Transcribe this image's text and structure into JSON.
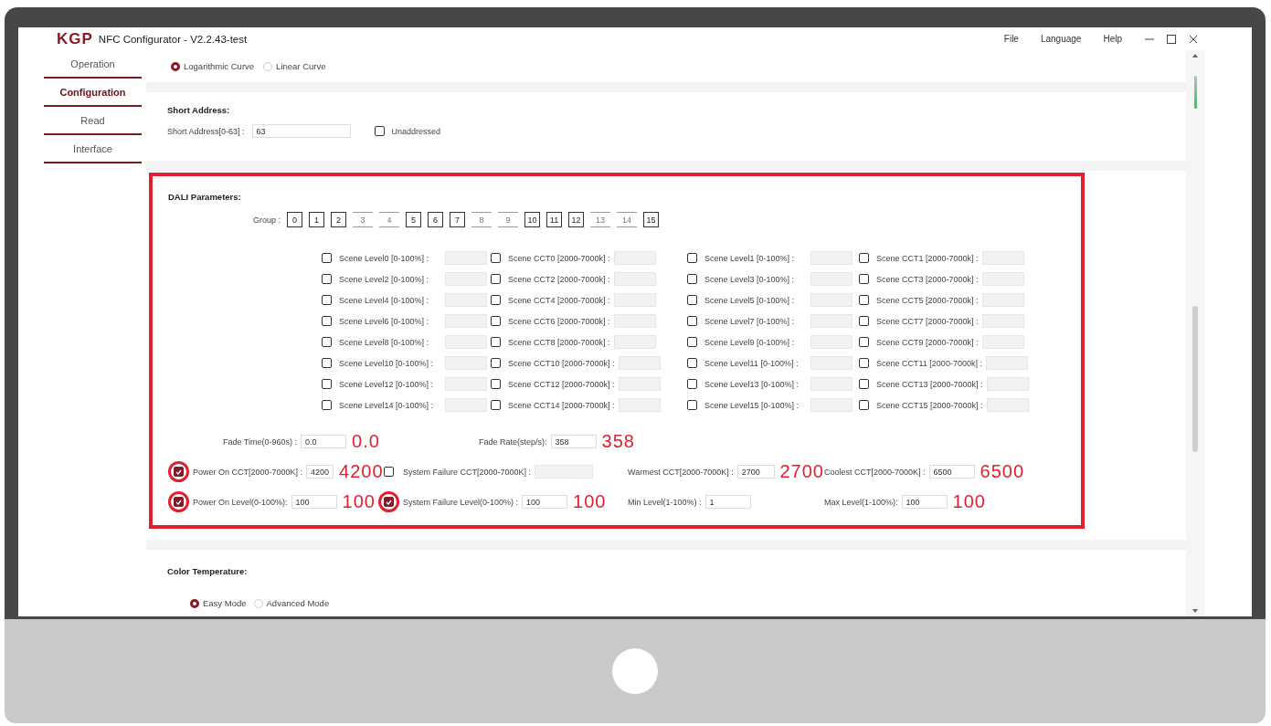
{
  "app": {
    "logo": "KGP",
    "title": "NFC Configurator - V2.2.43-test",
    "menu": [
      "File",
      "Language",
      "Help"
    ]
  },
  "sidebar": {
    "items": [
      {
        "label": "Operation",
        "selected": false
      },
      {
        "label": "Configuration",
        "selected": true
      },
      {
        "label": "Read",
        "selected": false
      },
      {
        "label": "Interface",
        "selected": false
      }
    ]
  },
  "curve": {
    "options": [
      {
        "label": "Logarithmic Curve",
        "selected": true
      },
      {
        "label": "Linear Curve",
        "selected": false
      }
    ]
  },
  "short_address": {
    "title": "Short Address:",
    "label": "Short Address[0-63] :",
    "value": "63",
    "unaddressed": {
      "label": "Unaddressed",
      "checked": false
    }
  },
  "dali": {
    "title": "DALI Parameters:",
    "group_label": "Group :",
    "groups": [
      {
        "label": "0",
        "selected": true
      },
      {
        "label": "1",
        "selected": true
      },
      {
        "label": "2",
        "selected": true
      },
      {
        "label": "3",
        "selected": false
      },
      {
        "label": "4",
        "selected": false
      },
      {
        "label": "5",
        "selected": true
      },
      {
        "label": "6",
        "selected": true
      },
      {
        "label": "7",
        "selected": true
      },
      {
        "label": "8",
        "selected": false
      },
      {
        "label": "9",
        "selected": false
      },
      {
        "label": "10",
        "selected": true
      },
      {
        "label": "11",
        "selected": true
      },
      {
        "label": "12",
        "selected": true
      },
      {
        "label": "13",
        "selected": false
      },
      {
        "label": "14",
        "selected": false
      },
      {
        "label": "15",
        "selected": true
      }
    ],
    "scenes": [
      {
        "label": "Scene Level0 [0-100%] :",
        "checked": false,
        "disabled": true
      },
      {
        "label": "Scene CCT0 [2000-7000k] :",
        "checked": false,
        "disabled": true
      },
      {
        "label": "Scene Level1 [0-100%] :",
        "checked": false,
        "disabled": true
      },
      {
        "label": "Scene CCT1 [2000-7000k] :",
        "checked": false,
        "disabled": true
      },
      {
        "label": "Scene Level2 [0-100%] :",
        "checked": false,
        "disabled": true
      },
      {
        "label": "Scene CCT2 [2000-7000k] :",
        "checked": false,
        "disabled": true
      },
      {
        "label": "Scene Level3 [0-100%] :",
        "checked": false,
        "disabled": true
      },
      {
        "label": "Scene CCT3 [2000-7000k] :",
        "checked": false,
        "disabled": true
      },
      {
        "label": "Scene Level4 [0-100%] :",
        "checked": false,
        "disabled": true
      },
      {
        "label": "Scene CCT4 [2000-7000k] :",
        "checked": false,
        "disabled": true
      },
      {
        "label": "Scene Level5 [0-100%] :",
        "checked": false,
        "disabled": true
      },
      {
        "label": "Scene CCT5 [2000-7000k] :",
        "checked": false,
        "disabled": true
      },
      {
        "label": "Scene Level6 [0-100%] :",
        "checked": false,
        "disabled": true
      },
      {
        "label": "Scene CCT6 [2000-7000k] :",
        "checked": false,
        "disabled": true
      },
      {
        "label": "Scene Level7 [0-100%] :",
        "checked": false,
        "disabled": true
      },
      {
        "label": "Scene CCT7 [2000-7000k] :",
        "checked": false,
        "disabled": true
      },
      {
        "label": "Scene Level8 [0-100%] :",
        "checked": false,
        "disabled": true
      },
      {
        "label": "Scene CCT8 [2000-7000k] :",
        "checked": false,
        "disabled": true
      },
      {
        "label": "Scene Level9 [0-100%] :",
        "checked": false,
        "disabled": true
      },
      {
        "label": "Scene CCT9 [2000-7000k] :",
        "checked": false,
        "disabled": true
      },
      {
        "label": "Scene Level10 [0-100%] :",
        "checked": false,
        "disabled": true
      },
      {
        "label": "Scene CCT10 [2000-7000k] :",
        "checked": false,
        "disabled": true
      },
      {
        "label": "Scene Level11 [0-100%] :",
        "checked": false,
        "disabled": true
      },
      {
        "label": "Scene CCT11 [2000-7000k] :",
        "checked": false,
        "disabled": true
      },
      {
        "label": "Scene Level12 [0-100%] :",
        "checked": false,
        "disabled": true
      },
      {
        "label": "Scene CCT12 [2000-7000k] :",
        "checked": false,
        "disabled": true
      },
      {
        "label": "Scene Level13 [0-100%] :",
        "checked": false,
        "disabled": true
      },
      {
        "label": "Scene CCT13 [2000-7000k] :",
        "checked": false,
        "disabled": true
      },
      {
        "label": "Scene Level14 [0-100%] :",
        "checked": false,
        "disabled": true
      },
      {
        "label": "Scene CCT14 [2000-7000k] :",
        "checked": false,
        "disabled": true
      },
      {
        "label": "Scene Level15 [0-100%] :",
        "checked": false,
        "disabled": true
      },
      {
        "label": "Scene CCT15 [2000-7000k] :",
        "checked": false,
        "disabled": true
      }
    ],
    "settings": [
      {
        "items": [
          {
            "kind": "field",
            "label": "Fade Time(0-960s) :",
            "value": "0.0",
            "annotation": "0.0"
          },
          {
            "kind": "field",
            "label": "Fade Rate(step/s):",
            "value": "358",
            "annotation": "358"
          }
        ]
      },
      {
        "items": [
          {
            "kind": "check-field",
            "label": "Power On CCT[2000-7000K] :",
            "value": "4200",
            "checked": true,
            "circled": true,
            "annotation": "4200"
          },
          {
            "kind": "check-field",
            "label": "System Failure CCT[2000-7000K] :",
            "checked": false,
            "circled": false,
            "disabled": true
          },
          {
            "kind": "field",
            "label": "Warmest CCT[2000-7000K] :",
            "value": "2700",
            "annotation": "2700"
          },
          {
            "kind": "field",
            "label": "Coolest CCT[2000-7000K] :",
            "value": "6500",
            "annotation": "6500"
          }
        ]
      },
      {
        "items": [
          {
            "kind": "check-field",
            "label": "Power On Level(0-100%):",
            "value": "100",
            "checked": true,
            "circled": true,
            "annotation": "100"
          },
          {
            "kind": "check-field",
            "label": "System Failure Level(0-100%) :",
            "value": "100",
            "checked": true,
            "circled": true,
            "annotation": "100"
          },
          {
            "kind": "field",
            "label": "Min Level(1-100%) :",
            "value": "1"
          },
          {
            "kind": "field",
            "label": "Max Level(1-100%):",
            "value": "100",
            "annotation": "100"
          }
        ]
      }
    ]
  },
  "color_temperature": {
    "title": "Color Temperature:",
    "options": [
      {
        "label": "Easy Mode",
        "selected": true
      },
      {
        "label": "Advanced Mode",
        "selected": false
      }
    ]
  }
}
